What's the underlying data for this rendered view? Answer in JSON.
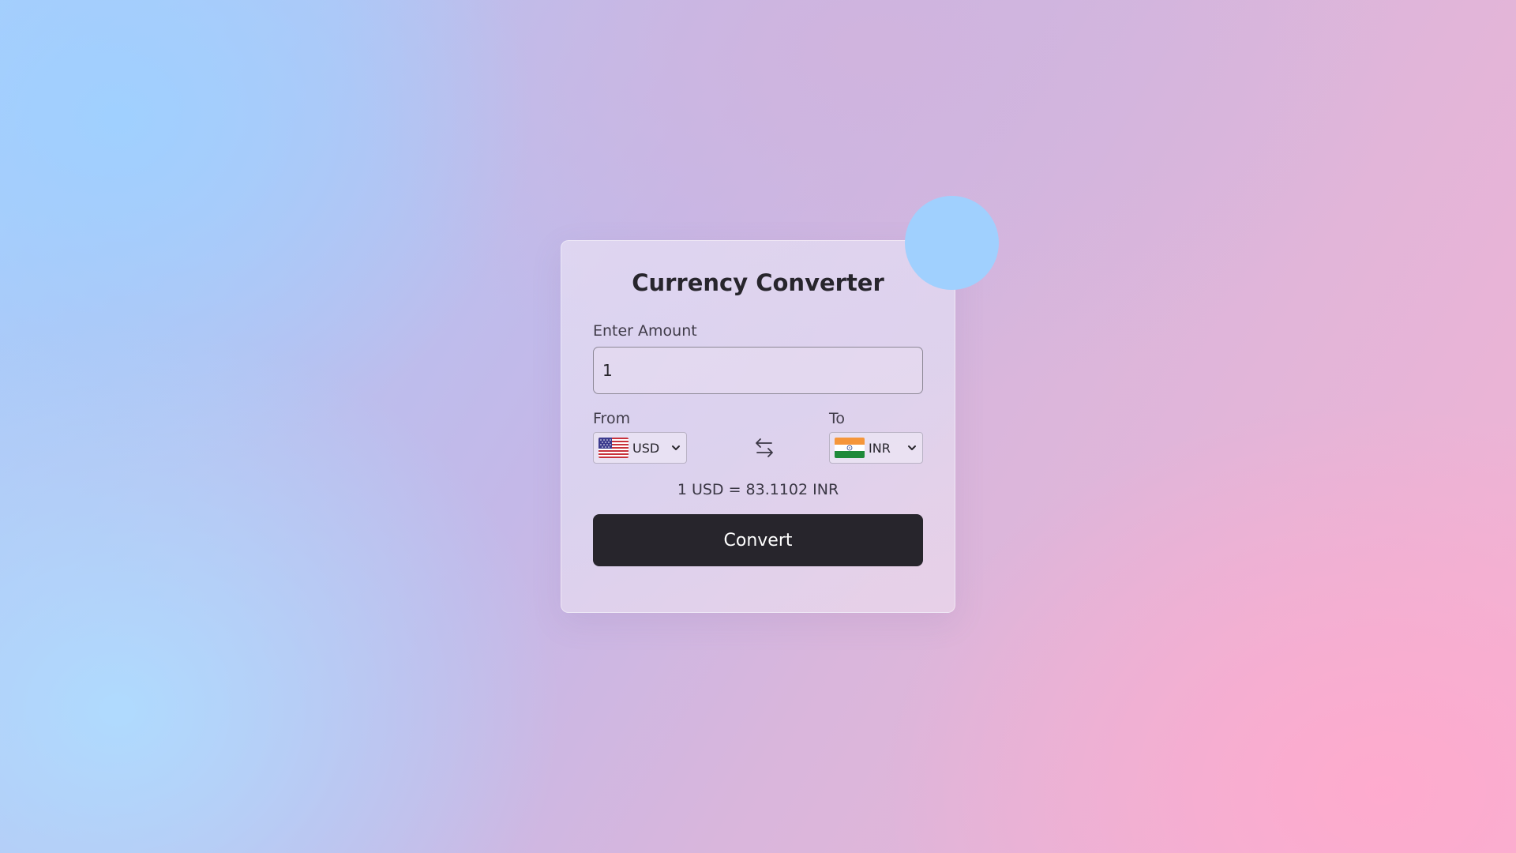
{
  "app": {
    "title": "Currency Converter"
  },
  "amount": {
    "label": "Enter Amount",
    "value": "1"
  },
  "from": {
    "label": "From",
    "currency": "USD",
    "flag_icon": "us-flag-icon"
  },
  "to": {
    "label": "To",
    "currency": "INR",
    "flag_icon": "india-flag-icon"
  },
  "rate_text": "1 USD = 83.1102 INR",
  "convert_label": "Convert",
  "colors": {
    "accent_button": "#27252c",
    "bubble": "#a0d0fe",
    "gradient_blue": "#a8cdfb",
    "gradient_pink": "#f3b3d3"
  }
}
